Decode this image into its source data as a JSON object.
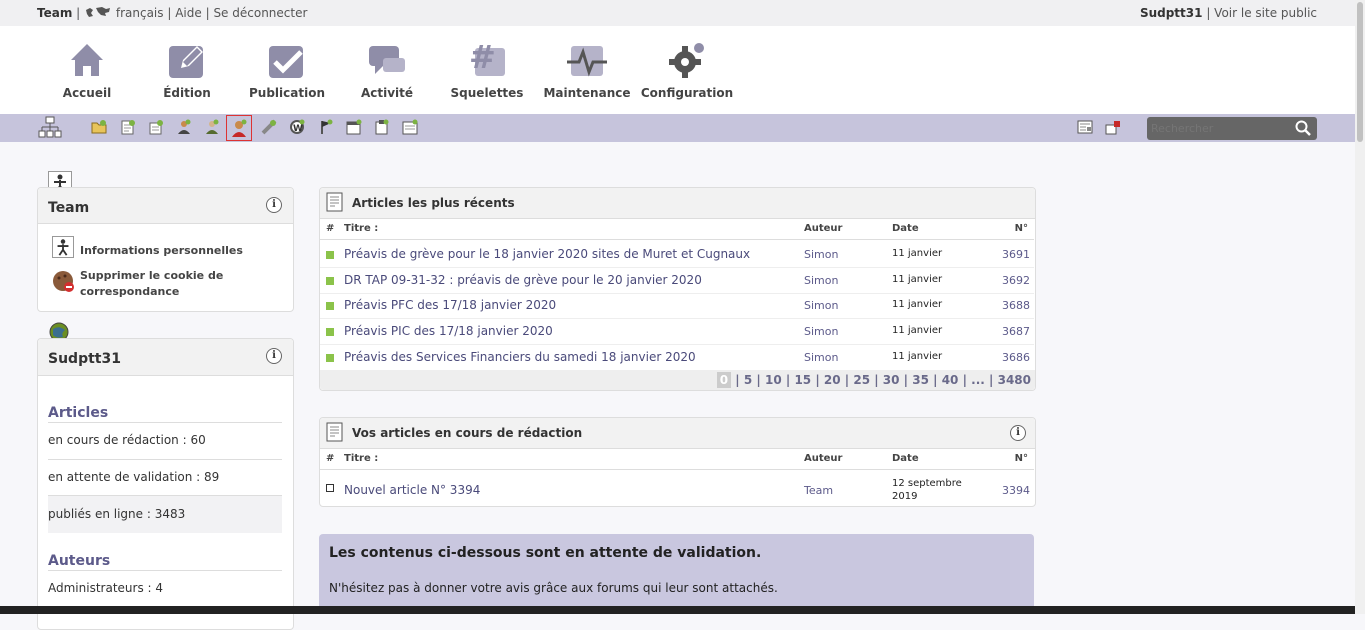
{
  "topbar": {
    "team": "Team",
    "language": "français",
    "help": "Aide",
    "logout": "Se déconnecter",
    "site": "Sudptt31",
    "public": "Voir le site public"
  },
  "nav": [
    {
      "label": "Accueil",
      "icon": "home-icon"
    },
    {
      "label": "Édition",
      "icon": "edit-icon"
    },
    {
      "label": "Publication",
      "icon": "publish-icon"
    },
    {
      "label": "Activité",
      "icon": "activity-icon"
    },
    {
      "label": "Squelettes",
      "icon": "templates-icon"
    },
    {
      "label": "Maintenance",
      "icon": "maintenance-icon"
    },
    {
      "label": "Configuration",
      "icon": "configuration-icon"
    }
  ],
  "search": {
    "placeholder": "Rechercher"
  },
  "sidebar": {
    "team_box": {
      "title": "Team",
      "link1": "Informations personnelles",
      "link2": "Supprimer le cookie de correspondance"
    },
    "site_box": {
      "title": "Sudptt31",
      "articles_heading": "Articles",
      "stats": [
        "en cours de rédaction : 60",
        "en attente de validation : 89",
        "publiés en ligne : 3483"
      ],
      "authors_heading": "Auteurs",
      "authors_stats": [
        "Administrateurs : 4"
      ]
    }
  },
  "recent": {
    "title": "Articles les plus récents",
    "cols": {
      "hash": "#",
      "titre": "Titre :",
      "auteur": "Auteur",
      "date": "Date",
      "num": "N°"
    },
    "rows": [
      {
        "title": "Préavis de grève pour le 18 janvier 2020 sites de Muret et Cugnaux",
        "author": "Simon",
        "date": "11 janvier",
        "num": "3691"
      },
      {
        "title": "DR TAP 09-31-32 : préavis de grève pour le 20 janvier 2020",
        "author": "Simon",
        "date": "11 janvier",
        "num": "3692"
      },
      {
        "title": "Préavis PFC des 17/18 janvier 2020",
        "author": "Simon",
        "date": "11 janvier",
        "num": "3688"
      },
      {
        "title": "Préavis PIC des 17/18 janvier 2020",
        "author": "Simon",
        "date": "11 janvier",
        "num": "3687"
      },
      {
        "title": "Préavis des Services Financiers du samedi 18 janvier 2020",
        "author": "Simon",
        "date": "11 janvier",
        "num": "3686"
      }
    ],
    "pagination": [
      "0",
      "5",
      "10",
      "15",
      "20",
      "25",
      "30",
      "35",
      "40",
      "...",
      "3480"
    ]
  },
  "drafts": {
    "title": "Vos articles en cours de rédaction",
    "cols": {
      "hash": "#",
      "titre": "Titre :",
      "auteur": "Auteur",
      "date": "Date",
      "num": "N°"
    },
    "rows": [
      {
        "title": "Nouvel article N° 3394",
        "author": "Team",
        "date": "12 septembre 2019",
        "num": "3394"
      }
    ]
  },
  "pending": {
    "title": "Les contenus ci-dessous sont en attente de validation.",
    "text": "N'hésitez pas à donner votre avis grâce aux forums qui leur sont attachés."
  }
}
